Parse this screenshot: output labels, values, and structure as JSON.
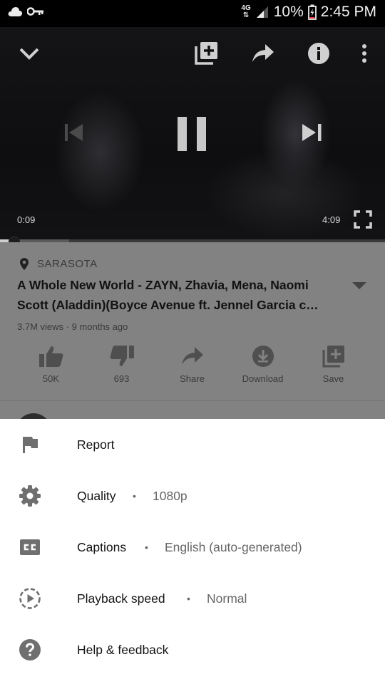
{
  "status_bar": {
    "network_type_top": "4G",
    "network_type_bottom": "",
    "battery_percent": "10%",
    "time": "2:45 PM"
  },
  "player": {
    "current_time": "0:09",
    "duration": "4:09",
    "progress_fraction": 0.036,
    "buffered_fraction": 0.18,
    "icons": [
      "collapse-icon",
      "add-to-playlist-icon",
      "share-icon",
      "info-icon",
      "more-icon",
      "previous-icon",
      "pause-icon",
      "next-icon",
      "fullscreen-icon"
    ]
  },
  "video": {
    "location": "SARASOTA",
    "title": "A Whole New World - ZAYN, Zhavia, Mena, Naomi Scott (Aladdin)(Boyce Avenue ft. Jennel Garcia c…",
    "meta": "3.7M views · 9 months ago",
    "actions": [
      {
        "label": "50K",
        "icon": "like-icon"
      },
      {
        "label": "693",
        "icon": "dislike-icon"
      },
      {
        "label": "Share",
        "icon": "share-icon"
      },
      {
        "label": "Download",
        "icon": "download-icon"
      },
      {
        "label": "Save",
        "icon": "save-icon"
      }
    ]
  },
  "menu": {
    "items": [
      {
        "label": "Report",
        "icon": "flag-icon"
      },
      {
        "label": "Quality",
        "icon": "gear-icon",
        "value": "1080p"
      },
      {
        "label": "Captions",
        "icon": "closed-captions-icon",
        "value": "English (auto-generated)"
      },
      {
        "label": "Playback speed",
        "icon": "playback-speed-icon",
        "value": "Normal"
      },
      {
        "label": "Help & feedback",
        "icon": "help-icon"
      }
    ],
    "separator": "•"
  },
  "colors": {
    "sheet_background": "#ffffff",
    "dim_overlay": "#828282",
    "menu_icon": "#6f6f6f"
  }
}
